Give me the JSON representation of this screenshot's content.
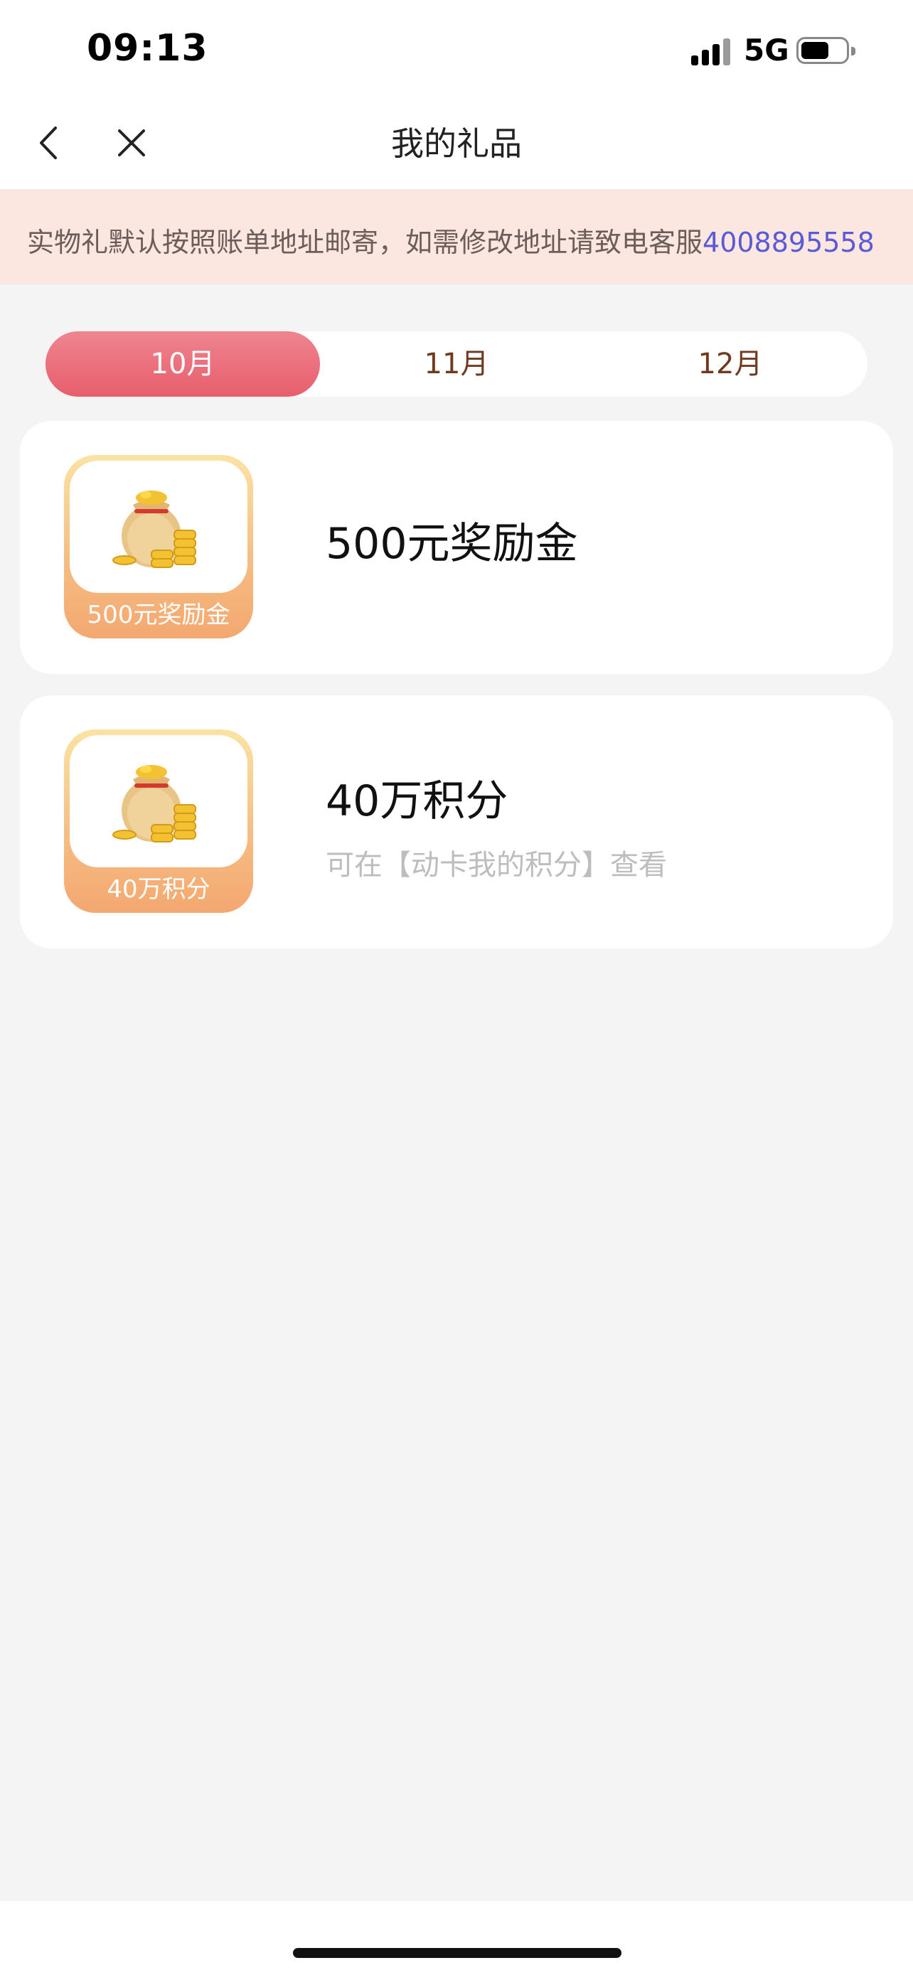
{
  "status_bar": {
    "time": "09:13",
    "network": "5G"
  },
  "navbar": {
    "title": "我的礼品",
    "back_icon": "chevron-left-icon",
    "close_icon": "close-icon"
  },
  "notice": {
    "text": "实物礼默认按照账单地址邮寄，如需修改地址请致电客服",
    "phone": "4008895558"
  },
  "tabs": [
    {
      "label": "10月",
      "active": true
    },
    {
      "label": "11月",
      "active": false
    },
    {
      "label": "12月",
      "active": false
    }
  ],
  "gifts": [
    {
      "thumb_label": "500元奖励金",
      "title": "500元奖励金",
      "description": "",
      "icon": "money-bag-icon"
    },
    {
      "thumb_label": "40万积分",
      "title": "40万积分",
      "description": "可在【动卡我的积分】查看",
      "icon": "money-bag-icon"
    }
  ],
  "colors": {
    "accent": "#e85e6c",
    "notice_bg": "#fbe6e0",
    "phone_link": "#5a5ad6",
    "tab_text": "#6e3b1f"
  }
}
